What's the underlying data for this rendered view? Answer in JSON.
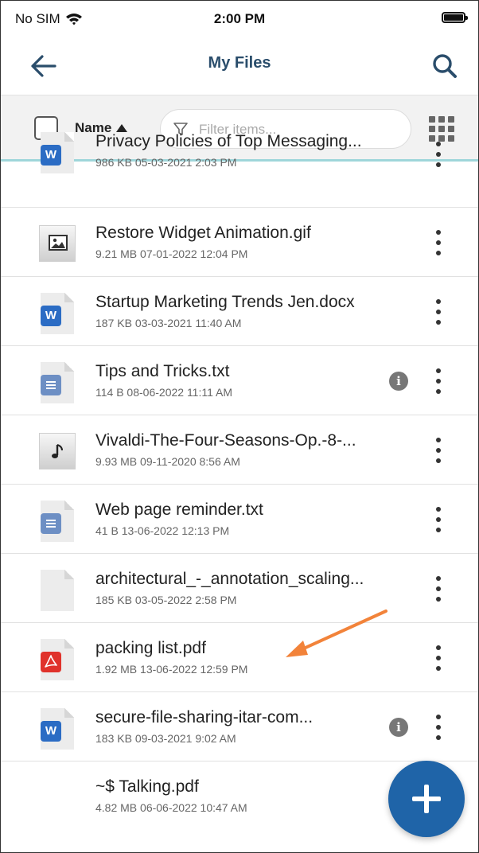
{
  "status_bar": {
    "carrier": "No SIM",
    "time": "2:00 PM"
  },
  "header": {
    "title": "My Files"
  },
  "toolbar": {
    "sort_label": "Name",
    "filter_placeholder": "Filter items..."
  },
  "files": [
    {
      "name": "Privacy Policies of Top Messaging...",
      "meta": "986 KB 05-03-2021 2:03 PM",
      "type": "word",
      "info": false
    },
    {
      "name": "Restore Widget Animation.gif",
      "meta": "9.21 MB 07-01-2022 12:04 PM",
      "type": "image",
      "info": false
    },
    {
      "name": "Startup Marketing Trends Jen.docx",
      "meta": "187 KB 03-03-2021 11:40 AM",
      "type": "word",
      "info": false
    },
    {
      "name": "Tips and Tricks.txt",
      "meta": "114 B 08-06-2022 11:11 AM",
      "type": "text",
      "info": true
    },
    {
      "name": "Vivaldi-The-Four-Seasons-Op.-8-...",
      "meta": "9.93 MB 09-11-2020 8:56 AM",
      "type": "audio",
      "info": false
    },
    {
      "name": "Web page reminder.txt",
      "meta": "41 B 13-06-2022 12:13 PM",
      "type": "text",
      "info": false
    },
    {
      "name": "architectural_-_annotation_scaling...",
      "meta": "185 KB 03-05-2022 2:58 PM",
      "type": "blank",
      "info": false
    },
    {
      "name": "packing list.pdf",
      "meta": "1.92 MB 13-06-2022 12:59 PM",
      "type": "pdf",
      "info": false
    },
    {
      "name": "secure-file-sharing-itar-com...",
      "meta": "183 KB 09-03-2021 9:02 AM",
      "type": "word",
      "info": true
    },
    {
      "name": "~$ Talking.pdf",
      "meta": "4.82 MB 06-06-2022 10:47 AM",
      "type": "blank",
      "info": false
    }
  ],
  "colors": {
    "accent": "#1f64a8",
    "title": "#2a4d6b",
    "divider_teal": "#9fd6da",
    "annotation_arrow": "#f2833a"
  }
}
